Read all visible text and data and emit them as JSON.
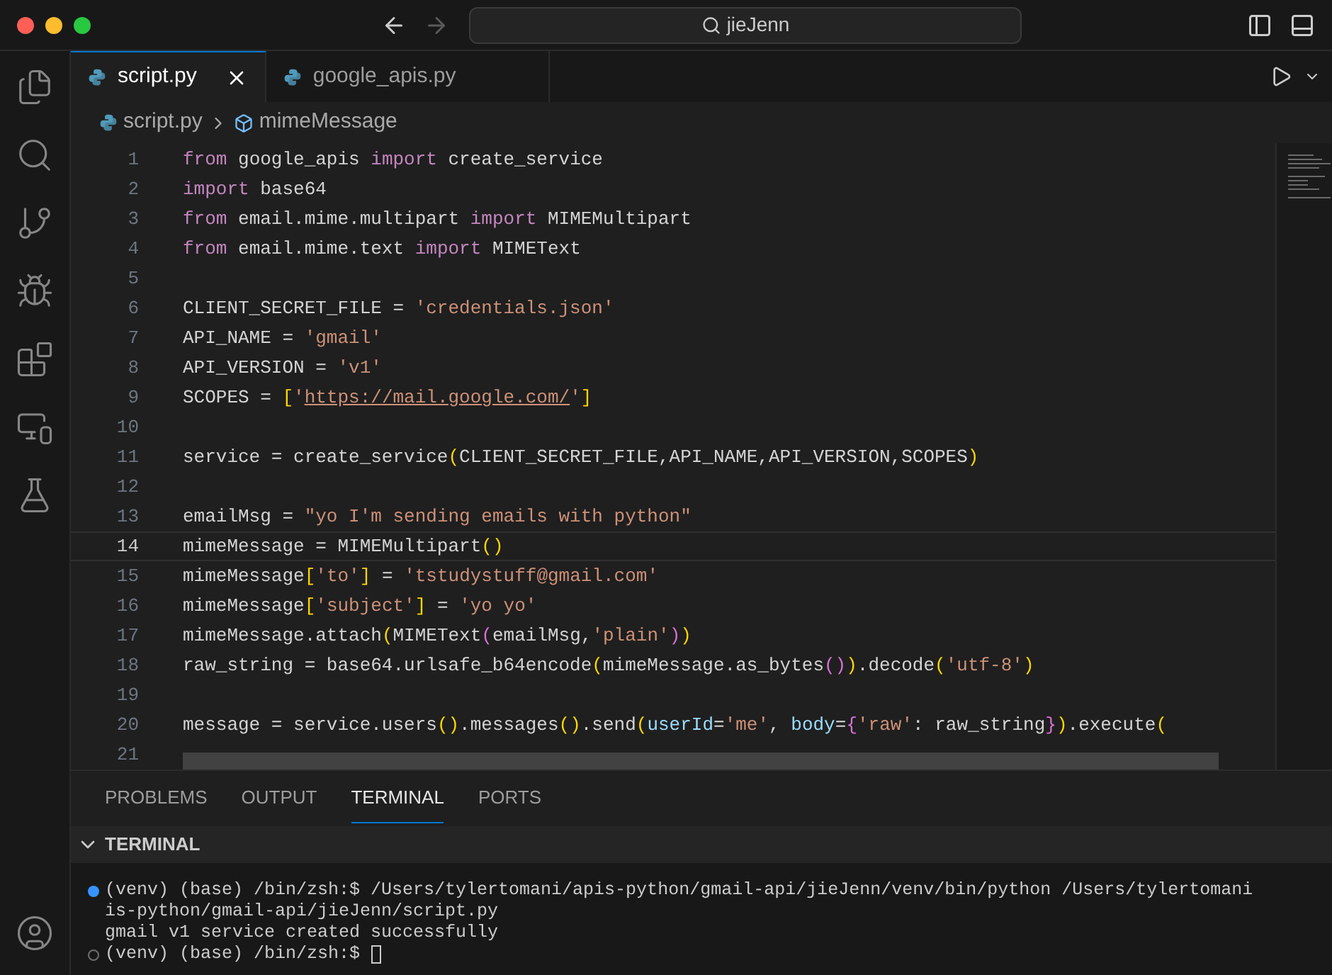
{
  "title_bar": {
    "search": "jieJenn"
  },
  "tabs": [
    {
      "label": "script.py",
      "selected": true
    },
    {
      "label": "google_apis.py",
      "selected": false
    }
  ],
  "breadcrumb": {
    "file": "script.py",
    "symbol": "mimeMessage"
  },
  "code": {
    "lines": [
      {
        "number": "1",
        "current": false,
        "tokens": [
          {
            "kind": "keyword",
            "text": "from"
          },
          {
            "kind": "plain",
            "text": " google_apis "
          },
          {
            "kind": "keyword",
            "text": "import"
          },
          {
            "kind": "plain",
            "text": " create_service"
          }
        ]
      },
      {
        "number": "2",
        "current": false,
        "tokens": [
          {
            "kind": "keyword",
            "text": "import"
          },
          {
            "kind": "plain",
            "text": " base64"
          }
        ]
      },
      {
        "number": "3",
        "current": false,
        "tokens": [
          {
            "kind": "keyword",
            "text": "from"
          },
          {
            "kind": "plain",
            "text": " email.mime.multipart "
          },
          {
            "kind": "keyword",
            "text": "import"
          },
          {
            "kind": "plain",
            "text": " MIMEMultipart"
          }
        ]
      },
      {
        "number": "4",
        "current": false,
        "tokens": [
          {
            "kind": "keyword",
            "text": "from"
          },
          {
            "kind": "plain",
            "text": " email.mime.text "
          },
          {
            "kind": "keyword",
            "text": "import"
          },
          {
            "kind": "plain",
            "text": " MIMEText"
          }
        ]
      },
      {
        "number": "5",
        "current": false
      },
      {
        "number": "6",
        "current": false,
        "tokens": [
          {
            "kind": "plain",
            "text": "CLIENT_SECRET_FILE = "
          },
          {
            "kind": "string",
            "text": "'credentials.json'"
          }
        ]
      },
      {
        "number": "7",
        "current": false,
        "tokens": [
          {
            "kind": "plain",
            "text": "API_NAME = "
          },
          {
            "kind": "string",
            "text": "'gmail'"
          }
        ]
      },
      {
        "number": "8",
        "current": false,
        "tokens": [
          {
            "kind": "plain",
            "text": "API_VERSION = "
          },
          {
            "kind": "string",
            "text": "'v1'"
          }
        ]
      },
      {
        "number": "9",
        "current": false,
        "tokens": [
          {
            "kind": "plain",
            "text": "SCOPES = "
          },
          {
            "kind": "bracket1",
            "text": "["
          },
          {
            "kind": "string",
            "text": "'"
          },
          {
            "kind": "link",
            "text": "https://mail.google.com/"
          },
          {
            "kind": "string",
            "text": "'"
          },
          {
            "kind": "bracket1",
            "text": "]"
          }
        ]
      },
      {
        "number": "10",
        "current": false
      },
      {
        "number": "11",
        "current": false,
        "tokens": [
          {
            "kind": "plain",
            "text": "service = create_service"
          },
          {
            "kind": "bracket1",
            "text": "("
          },
          {
            "kind": "plain",
            "text": "CLIENT_SECRET_FILE,API_NAME,API_VERSION,SCOPES"
          },
          {
            "kind": "bracket1",
            "text": ")"
          }
        ]
      },
      {
        "number": "12",
        "current": false
      },
      {
        "number": "13",
        "current": false,
        "tokens": [
          {
            "kind": "plain",
            "text": "emailMsg = "
          },
          {
            "kind": "string",
            "text": "\"yo I'm sending emails with python\""
          }
        ]
      },
      {
        "number": "14",
        "current": true,
        "tokens": [
          {
            "kind": "plain",
            "text": "mimeMessage = MIMEMultipart"
          },
          {
            "kind": "bracket1",
            "text": "()"
          }
        ]
      },
      {
        "number": "15",
        "current": false,
        "tokens": [
          {
            "kind": "plain",
            "text": "mimeMessage"
          },
          {
            "kind": "bracket1",
            "text": "["
          },
          {
            "kind": "string",
            "text": "'to'"
          },
          {
            "kind": "bracket1",
            "text": "]"
          },
          {
            "kind": "plain",
            "text": " = "
          },
          {
            "kind": "string",
            "text": "'tstudystuff@gmail.com'"
          }
        ]
      },
      {
        "number": "16",
        "current": false,
        "tokens": [
          {
            "kind": "plain",
            "text": "mimeMessage"
          },
          {
            "kind": "bracket1",
            "text": "["
          },
          {
            "kind": "string",
            "text": "'subject'"
          },
          {
            "kind": "bracket1",
            "text": "]"
          },
          {
            "kind": "plain",
            "text": " = "
          },
          {
            "kind": "string",
            "text": "'yo yo'"
          }
        ]
      },
      {
        "number": "17",
        "current": false,
        "tokens": [
          {
            "kind": "plain",
            "text": "mimeMessage.attach"
          },
          {
            "kind": "bracket1",
            "text": "("
          },
          {
            "kind": "plain",
            "text": "MIMEText"
          },
          {
            "kind": "bracket2",
            "text": "("
          },
          {
            "kind": "plain",
            "text": "emailMsg,"
          },
          {
            "kind": "string",
            "text": "'plain'"
          },
          {
            "kind": "bracket2",
            "text": ")"
          },
          {
            "kind": "bracket1",
            "text": ")"
          }
        ]
      },
      {
        "number": "18",
        "current": false,
        "tokens": [
          {
            "kind": "plain",
            "text": "raw_string = base64.urlsafe_b64encode"
          },
          {
            "kind": "bracket1",
            "text": "("
          },
          {
            "kind": "plain",
            "text": "mimeMessage.as_bytes"
          },
          {
            "kind": "bracket2",
            "text": "()"
          },
          {
            "kind": "bracket1",
            "text": ")"
          },
          {
            "kind": "plain",
            "text": ".decode"
          },
          {
            "kind": "bracket1",
            "text": "("
          },
          {
            "kind": "string",
            "text": "'utf-8'"
          },
          {
            "kind": "bracket1",
            "text": ")"
          }
        ]
      },
      {
        "number": "19",
        "current": false
      },
      {
        "number": "20",
        "current": false,
        "tokens": [
          {
            "kind": "plain",
            "text": "message = service.users"
          },
          {
            "kind": "bracket1",
            "text": "()"
          },
          {
            "kind": "plain",
            "text": ".messages"
          },
          {
            "kind": "bracket1",
            "text": "()"
          },
          {
            "kind": "plain",
            "text": ".send"
          },
          {
            "kind": "bracket1",
            "text": "("
          },
          {
            "kind": "param",
            "text": "userId"
          },
          {
            "kind": "plain",
            "text": "="
          },
          {
            "kind": "string",
            "text": "'me'"
          },
          {
            "kind": "plain",
            "text": ", "
          },
          {
            "kind": "param",
            "text": "body"
          },
          {
            "kind": "plain",
            "text": "="
          },
          {
            "kind": "bracket2",
            "text": "{"
          },
          {
            "kind": "string",
            "text": "'raw'"
          },
          {
            "kind": "plain",
            "text": ": raw_string"
          },
          {
            "kind": "bracket2",
            "text": "}"
          },
          {
            "kind": "bracket1",
            "text": ")"
          },
          {
            "kind": "plain",
            "text": ".execute"
          },
          {
            "kind": "bracket1",
            "text": "("
          }
        ]
      },
      {
        "number": "21",
        "current": false
      }
    ]
  },
  "panel_tabs": [
    {
      "label": "PROBLEMS",
      "selected": false
    },
    {
      "label": "OUTPUT",
      "selected": false
    },
    {
      "label": "TERMINAL",
      "selected": true
    },
    {
      "label": "PORTS",
      "selected": false
    }
  ],
  "terminal": {
    "header": "TERMINAL",
    "lines": [
      {
        "kind": "prompt",
        "text": "(venv) (base) /bin/zsh:$ /Users/tylertomani/apis-python/gmail-api/jieJenn/venv/bin/python /Users/tylertomani"
      },
      {
        "kind": "output",
        "text": "is-python/gmail-api/jieJenn/script.py"
      },
      {
        "kind": "output",
        "text": "gmail v1 service created successfully"
      },
      {
        "kind": "current",
        "text": "(venv) (base) /bin/zsh:$"
      }
    ]
  }
}
